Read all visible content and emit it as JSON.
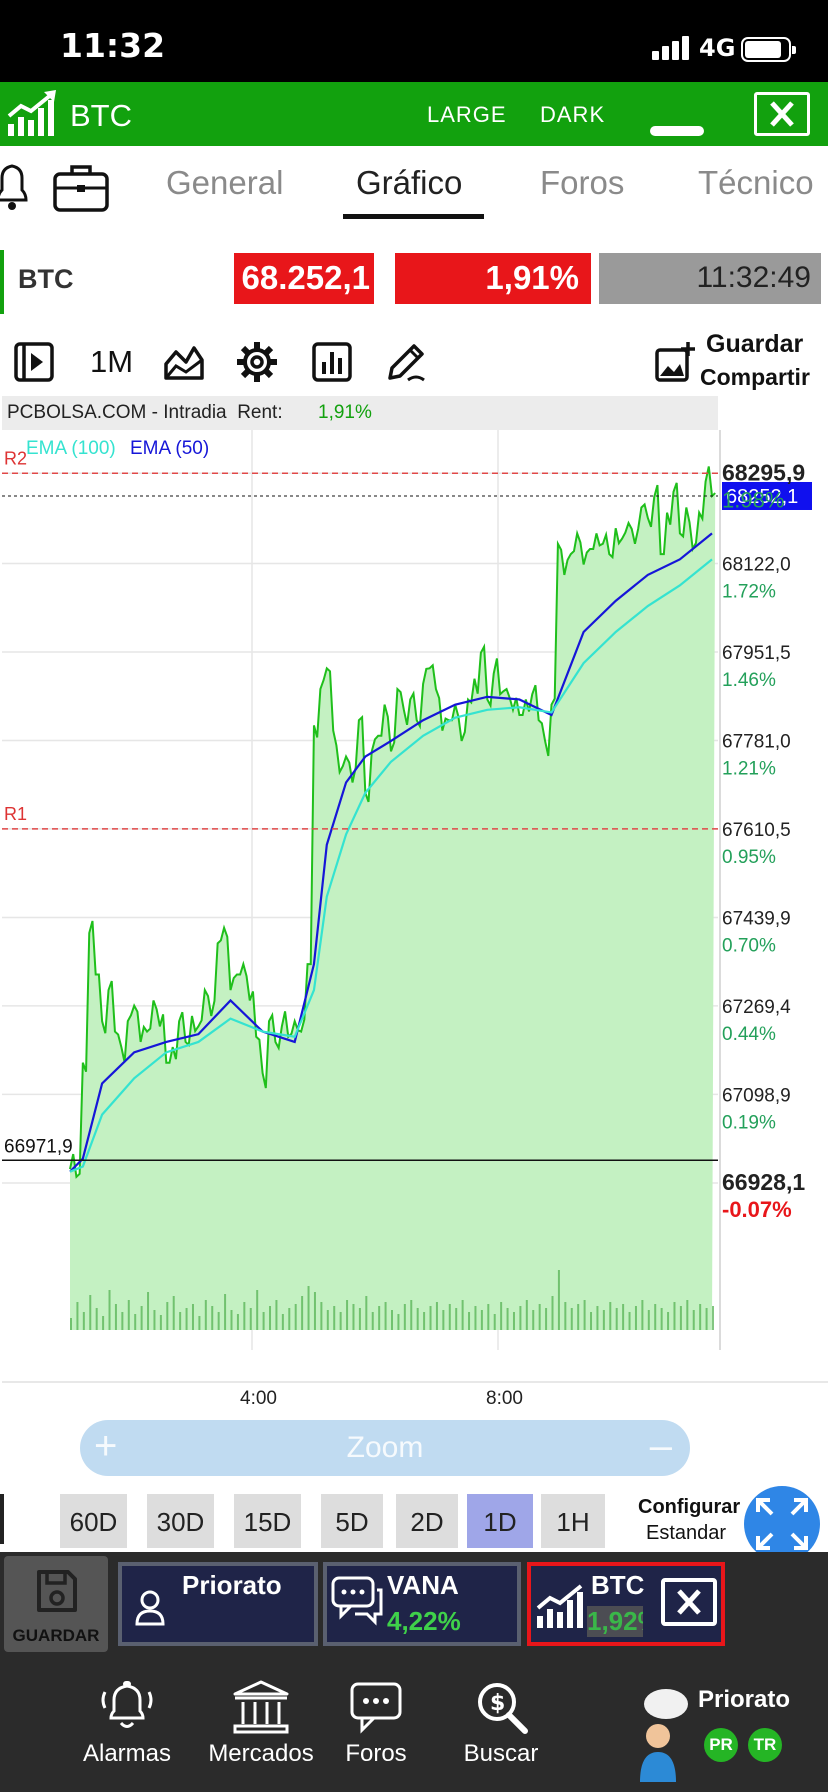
{
  "status_bar": {
    "time": "11:32",
    "network": "4G"
  },
  "header": {
    "title": "BTC",
    "large_label": "LARGE",
    "dark_label": "DARK"
  },
  "tabs": [
    {
      "label": "General"
    },
    {
      "label": "Gráfico"
    },
    {
      "label": "Foros"
    },
    {
      "label": "Técnico"
    }
  ],
  "active_tab": "Gráfico",
  "quote": {
    "symbol": "BTC",
    "price": "68.252,1",
    "change_pct": "1,91%",
    "time": "11:32:49"
  },
  "toolbar": {
    "period": "1M",
    "save_label": "Guardar",
    "share_label": "Compartir"
  },
  "chart_head": {
    "source": "PCBOLSA.COM - Intradia",
    "rent_label": "Rent:",
    "rent_value": "1,91%"
  },
  "chart_data": {
    "type": "area",
    "legend": [
      {
        "name": "EMA (100)",
        "color": "#35e3d0"
      },
      {
        "name": "EMA (50)",
        "color": "#1616d8"
      }
    ],
    "x_tick_labels": [
      "4:00",
      "8:00"
    ],
    "ylim": [
      66880,
      68360
    ],
    "y_ticks": [
      {
        "price": "68295,9",
        "pct": "1.98%",
        "v": 68295.9
      },
      {
        "price": "68122,0",
        "pct": "1.72%",
        "v": 68122.0
      },
      {
        "price": "67951,5",
        "pct": "1.46%",
        "v": 67951.5
      },
      {
        "price": "67781,0",
        "pct": "1.21%",
        "v": 67781.0
      },
      {
        "price": "67610,5",
        "pct": "0.95%",
        "v": 67610.5
      },
      {
        "price": "67439,9",
        "pct": "0.70%",
        "v": 67439.9
      },
      {
        "price": "67269,4",
        "pct": "0.44%",
        "v": 67269.4
      },
      {
        "price": "67098,9",
        "pct": "0.19%",
        "v": 67098.9
      },
      {
        "price": "66928,1",
        "pct": "-0.07%",
        "v": 66928.1
      }
    ],
    "resistances": [
      {
        "name": "R2",
        "value": 68295.9
      },
      {
        "name": "R1",
        "value": 67610.5
      }
    ],
    "reference_line": {
      "label": "66971,9",
      "value": 66971.9
    },
    "last_price": {
      "label": "68252,1",
      "value": 68252.1
    },
    "series": [
      {
        "name": "BTC",
        "x": [
          0,
          1,
          2,
          3,
          4,
          5,
          6,
          7,
          8,
          9,
          10,
          11,
          12,
          13,
          14,
          15,
          16,
          17,
          18,
          19,
          20,
          21,
          22,
          23,
          24,
          25,
          26,
          27,
          28,
          29,
          30,
          31,
          32,
          33,
          34,
          35,
          36,
          37,
          38,
          39,
          40,
          41,
          42,
          43,
          44,
          45,
          46,
          47,
          48,
          49,
          50,
          51,
          52,
          53,
          54,
          55,
          56,
          57,
          58,
          59,
          60,
          61,
          62,
          63,
          64,
          65,
          66,
          67,
          68,
          69,
          70,
          71,
          72,
          73,
          74,
          75,
          76,
          77,
          78,
          79,
          80,
          81,
          82,
          83,
          84,
          85,
          86,
          87,
          88,
          89,
          90,
          91,
          92,
          93,
          94,
          95,
          96,
          97,
          98,
          99,
          100
        ],
        "values": [
          66955,
          66940,
          67160,
          67410,
          67330,
          67240,
          67300,
          67220,
          67190,
          67240,
          67270,
          67200,
          67220,
          67280,
          67230,
          67160,
          67190,
          67240,
          67200,
          67250,
          67230,
          67300,
          67250,
          67390,
          67420,
          67300,
          67330,
          67350,
          67280,
          67210,
          67140,
          67240,
          67200,
          67230,
          67210,
          67240,
          67220,
          67350,
          67810,
          67880,
          67920,
          67800,
          67720,
          67750,
          67700,
          67820,
          67680,
          67760,
          67790,
          67850,
          67760,
          67880,
          67840,
          67860,
          67820,
          67890,
          67920,
          67880,
          67800,
          67820,
          67850,
          67780,
          67860,
          67900,
          67950,
          67860,
          67910,
          67870,
          67880,
          67840,
          67830,
          67860,
          67870,
          67820,
          67780,
          67850,
          68160,
          68100,
          68140,
          68180,
          68120,
          68150,
          68180,
          68160,
          68140,
          68190,
          68170,
          68200,
          68160,
          68230,
          68210,
          68250,
          68140,
          68220,
          68260,
          68180,
          68230,
          68150,
          68220,
          68280,
          68252
        ]
      },
      {
        "name": "EMA (50)",
        "x": [
          0,
          2,
          5,
          10,
          15,
          20,
          25,
          30,
          35,
          38,
          40,
          43,
          46,
          50,
          55,
          60,
          65,
          70,
          75,
          80,
          85,
          90,
          95,
          100
        ],
        "values": [
          66950,
          66975,
          67120,
          67180,
          67200,
          67215,
          67280,
          67220,
          67200,
          67350,
          67580,
          67700,
          67750,
          67780,
          67820,
          67850,
          67865,
          67860,
          67830,
          67990,
          68050,
          68100,
          68130,
          68180
        ]
      },
      {
        "name": "EMA (100)",
        "x": [
          0,
          2,
          5,
          10,
          15,
          20,
          25,
          30,
          35,
          38,
          40,
          43,
          46,
          50,
          55,
          60,
          65,
          70,
          75,
          80,
          85,
          90,
          95,
          100
        ],
        "values": [
          66950,
          66960,
          67060,
          67130,
          67180,
          67200,
          67245,
          67220,
          67210,
          67300,
          67480,
          67600,
          67680,
          67740,
          67790,
          67825,
          67840,
          67845,
          67835,
          67930,
          67990,
          68040,
          68080,
          68130
        ]
      }
    ],
    "volume": [
      12,
      28,
      18,
      35,
      22,
      14,
      40,
      26,
      18,
      30,
      16,
      24,
      38,
      20,
      15,
      28,
      34,
      18,
      22,
      26,
      14,
      30,
      24,
      18,
      36,
      20,
      16,
      28,
      22,
      40,
      18,
      24,
      30,
      16,
      22,
      26,
      34,
      44,
      38,
      28,
      20,
      24,
      18,
      30,
      26,
      22,
      34,
      18,
      24,
      28,
      20,
      16,
      26,
      30,
      22,
      18,
      24,
      28,
      20,
      26,
      22,
      30,
      18,
      24,
      20,
      26,
      16,
      28,
      22,
      18,
      24,
      30,
      20,
      26,
      22,
      34,
      60,
      28,
      22,
      26,
      30,
      18,
      24,
      20,
      28,
      22,
      26,
      18,
      24,
      30,
      20,
      26,
      22,
      18,
      28,
      24,
      30,
      20,
      26,
      22,
      24
    ]
  },
  "zoom_label": "Zoom",
  "ranges": [
    {
      "label": "60D"
    },
    {
      "label": "30D"
    },
    {
      "label": "15D"
    },
    {
      "label": "5D"
    },
    {
      "label": "2D"
    },
    {
      "label": "1D"
    },
    {
      "label": "1H"
    }
  ],
  "active_range": "1D",
  "config": {
    "line1": "Configurar",
    "line2": "Estandar"
  },
  "watch_panel": {
    "save_label": "GUARDAR",
    "items": [
      {
        "name": "Priorato"
      },
      {
        "name": "VANA",
        "change": "4,22%"
      },
      {
        "name": "BTC",
        "change": "1,92%"
      }
    ]
  },
  "bottom_nav": [
    {
      "label": "Alarmas"
    },
    {
      "label": "Mercados"
    },
    {
      "label": "Foros"
    },
    {
      "label": "Buscar"
    }
  ],
  "user": {
    "name": "Priorato",
    "badge1": "PR",
    "badge2": "TR"
  },
  "colors": {
    "brand_green": "#12a10e",
    "price_red": "#e8161a",
    "area_fill": "#c4f1c2",
    "line_green": "#1fbf1b"
  }
}
